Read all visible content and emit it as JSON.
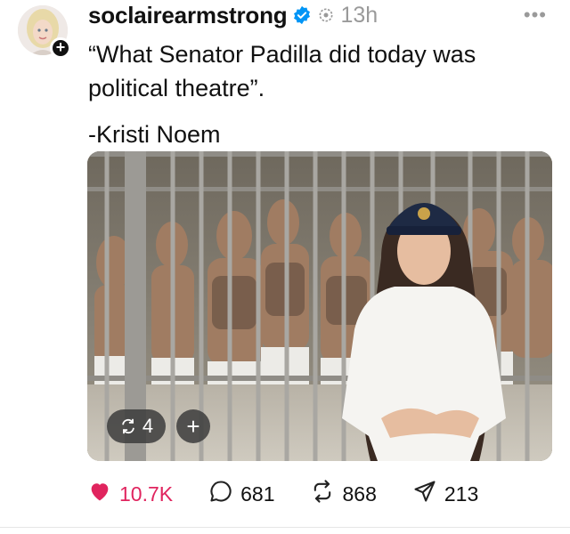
{
  "post": {
    "username": "soclairearmstrong",
    "time": "13h",
    "more_label": "•••",
    "text_line1": "“What Senator Padilla did today was",
    "text_line2": "political theatre”.",
    "text_sig": "-Kristi Noem",
    "media": {
      "quote_count": "4",
      "add_label": "+"
    },
    "actions": {
      "likes": "10.7K",
      "replies": "681",
      "reposts": "868",
      "shares": "213"
    }
  },
  "colors": {
    "like": "#e0245e",
    "verified": "#0095f6"
  },
  "icons": [
    "avatar",
    "follow-plus-icon",
    "verified-badge-icon",
    "repost-mini-icon",
    "more-icon",
    "quote-icon",
    "add-icon",
    "heart-icon",
    "reply-icon",
    "repost-icon",
    "share-icon"
  ]
}
